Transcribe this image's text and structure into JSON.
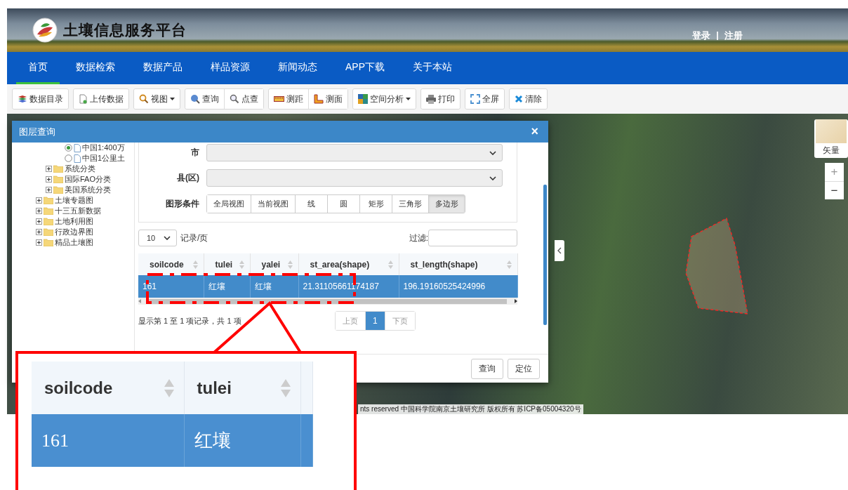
{
  "header": {
    "title": "土壤信息服务平台",
    "login": "登录",
    "separator": "|",
    "register": "注册"
  },
  "nav": [
    {
      "label": "首页",
      "selected": true
    },
    {
      "label": "数据检索",
      "selected": false
    },
    {
      "label": "数据产品",
      "selected": false
    },
    {
      "label": "样品资源",
      "selected": false
    },
    {
      "label": "新闻动态",
      "selected": false
    },
    {
      "label": "APP下载",
      "selected": false
    },
    {
      "label": "关于本站",
      "selected": false
    }
  ],
  "toolbar": [
    [
      {
        "label": "数据目录",
        "dropdown": false
      }
    ],
    [
      {
        "label": "上传数据",
        "dropdown": false
      }
    ],
    [
      {
        "label": "视图",
        "dropdown": true
      }
    ],
    [
      {
        "label": "查询",
        "dropdown": false
      },
      {
        "label": "点查",
        "dropdown": false
      }
    ],
    [
      {
        "label": "测距",
        "dropdown": false
      },
      {
        "label": "测面",
        "dropdown": false
      }
    ],
    [
      {
        "label": "空间分析",
        "dropdown": true
      }
    ],
    [
      {
        "label": "打印",
        "dropdown": false
      }
    ],
    [
      {
        "label": "全屏",
        "dropdown": false
      }
    ],
    [
      {
        "label": "清除",
        "dropdown": false
      }
    ]
  ],
  "map": {
    "layer_switch": "矢量",
    "zoom_in": "+",
    "zoom_out": "−",
    "attribution": "nts reserved 中国科学院南京土壤研究所 版权所有 苏ICP备05004320号"
  },
  "dialog": {
    "title": "图层查询",
    "close": "×",
    "tree": [
      {
        "kind": "group",
        "children": [
          {
            "kind": "group",
            "children": [
              {
                "kind": "radio",
                "label": "中国1:400万",
                "checked": true
              },
              {
                "kind": "radio",
                "label": "中国1公里土",
                "checked": false
              }
            ]
          },
          {
            "kind": "folder",
            "label": "系统分类",
            "expanded": false
          },
          {
            "kind": "folder",
            "label": "国际FAO分类",
            "expanded": false
          },
          {
            "kind": "folder",
            "label": "美国系统分类",
            "expanded": false
          }
        ]
      },
      {
        "kind": "folder",
        "label": "土壤专题图",
        "expanded": false
      },
      {
        "kind": "folder",
        "label": "十三五新数据",
        "expanded": false
      },
      {
        "kind": "folder",
        "label": "土地利用图",
        "expanded": false
      },
      {
        "kind": "folder",
        "label": "行政边界图",
        "expanded": false
      },
      {
        "kind": "folder",
        "label": "精品土壤图",
        "expanded": false
      }
    ],
    "city_label": "市",
    "county_label": "县(区)",
    "shape_label": "图形条件",
    "shapes": [
      {
        "label": "全局视图",
        "selected": false
      },
      {
        "label": "当前视图",
        "selected": false
      },
      {
        "label": "线",
        "selected": false
      },
      {
        "label": "圆",
        "selected": false
      },
      {
        "label": "矩形",
        "selected": false
      },
      {
        "label": "三角形",
        "selected": false
      },
      {
        "label": "多边形",
        "selected": true
      }
    ],
    "page_size": "10",
    "page_size_suffix": "记录/页",
    "filter_label": "过滤:",
    "table": {
      "columns": [
        "soilcode",
        "tulei",
        "yalei",
        "st_area(shape)",
        "st_length(shape)"
      ],
      "rows": [
        {
          "cells": [
            "161",
            "红壤",
            "红壤",
            "21.31105661174187",
            "196.19160525424996"
          ],
          "selected": true
        }
      ]
    },
    "summary": "显示第 1 至 1 项记录，共 1 项",
    "pagination": [
      {
        "label": "上页",
        "selected": false
      },
      {
        "label": "1",
        "selected": true
      },
      {
        "label": "下页",
        "selected": false
      }
    ],
    "buttons": [
      "查询",
      "定位"
    ]
  },
  "callout": {
    "columns": [
      "soilcode",
      "tulei"
    ],
    "row": {
      "cells": [
        "161",
        "红壤"
      ],
      "selected": true
    }
  }
}
